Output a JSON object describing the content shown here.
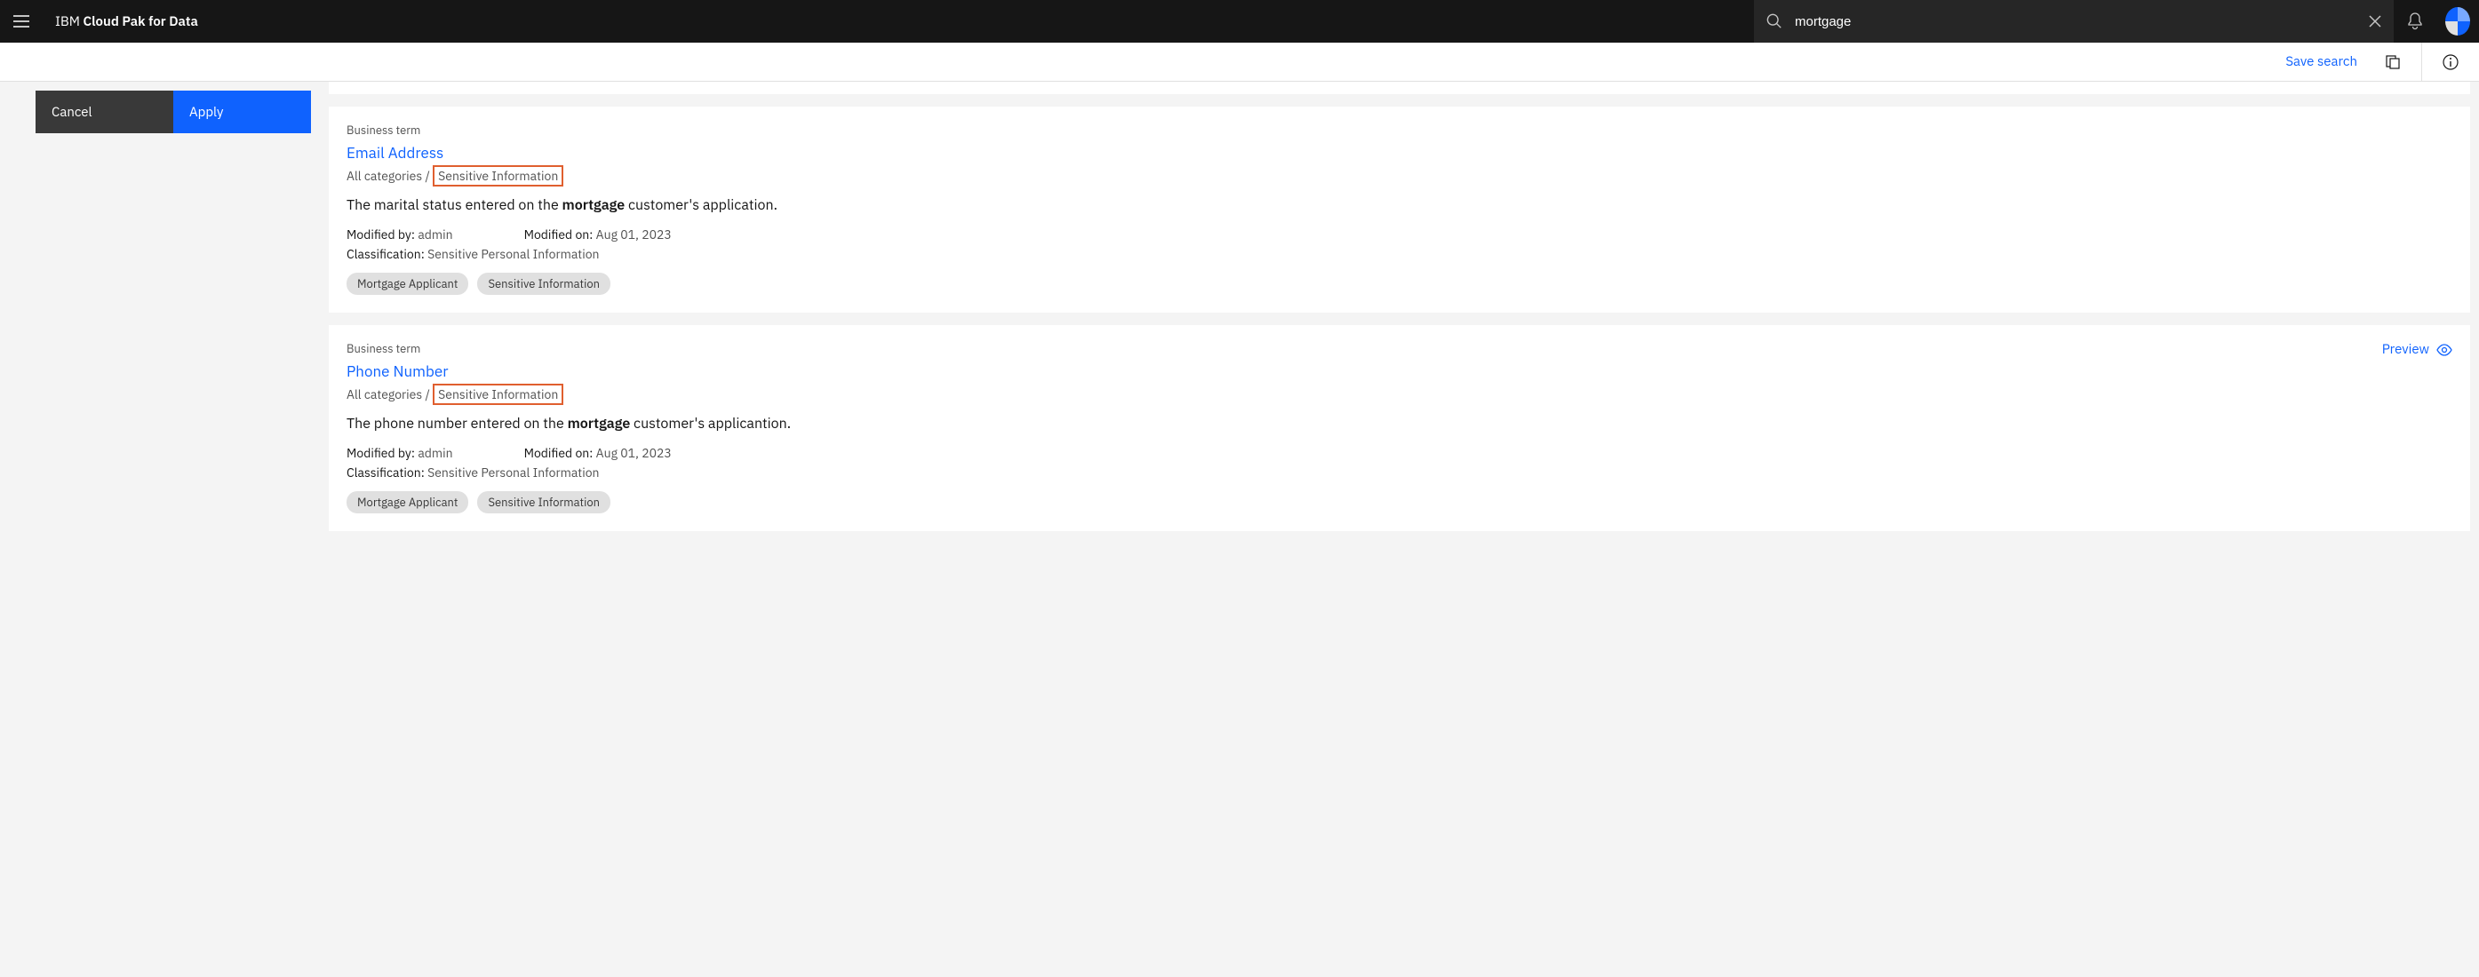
{
  "header": {
    "brand_prefix": "IBM ",
    "brand_main": "Cloud Pak for Data",
    "search_value": "mortgage"
  },
  "subbar": {
    "save_search": "Save search"
  },
  "sidebar": {
    "cancel": "Cancel",
    "apply": "Apply"
  },
  "results": [
    {
      "type": "Business term",
      "title": "Email Address",
      "breadcrumb_prefix": "All categories / ",
      "breadcrumb_hl": "Sensitive Information",
      "desc_before": "The marital status entered on the ",
      "desc_bold": "mortgage",
      "desc_after": " customer's application.",
      "modified_by_label": "Modified by: ",
      "modified_by": "admin",
      "modified_on_label": "Modified on: ",
      "modified_on": "Aug 01, 2023",
      "classification_label": "Classification: ",
      "classification": "Sensitive Personal Information",
      "tags": [
        "Mortgage Applicant",
        "Sensitive Information"
      ],
      "show_preview": false
    },
    {
      "type": "Business term",
      "title": "Phone Number",
      "breadcrumb_prefix": "All categories / ",
      "breadcrumb_hl": "Sensitive Information",
      "desc_before": "The phone number entered on the ",
      "desc_bold": "mortgage",
      "desc_after": " customer's applicantion.",
      "modified_by_label": "Modified by: ",
      "modified_by": "admin",
      "modified_on_label": "Modified on: ",
      "modified_on": "Aug 01, 2023",
      "classification_label": "Classification: ",
      "classification": "Sensitive Personal Information",
      "tags": [
        "Mortgage Applicant",
        "Sensitive Information"
      ],
      "show_preview": true,
      "preview_label": "Preview"
    }
  ]
}
